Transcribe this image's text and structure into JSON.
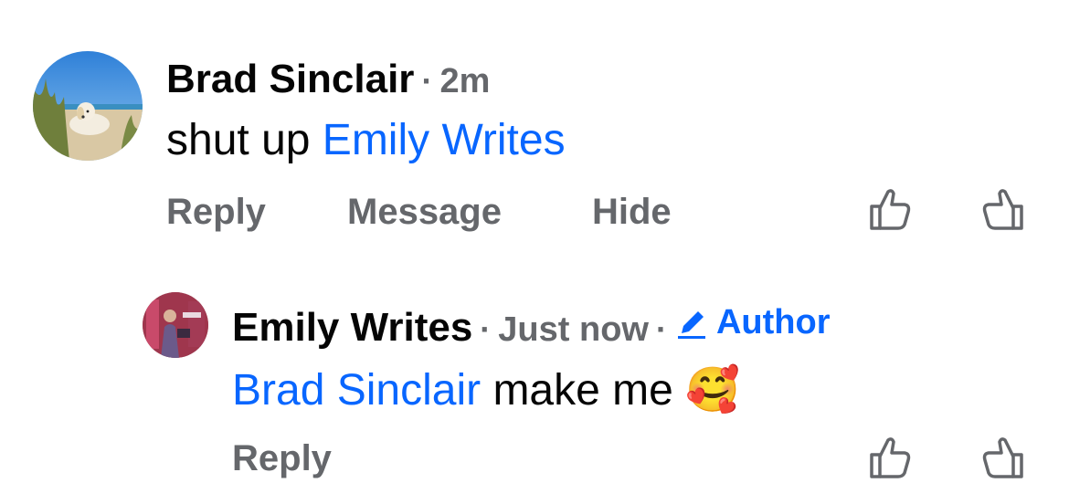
{
  "comments": [
    {
      "author": "Brad Sinclair",
      "separator": "·",
      "time": "2m",
      "body_prefix": "shut up ",
      "mention": "Emily Writes",
      "actions": {
        "reply": "Reply",
        "message": "Message",
        "hide": "Hide"
      },
      "avatar_icon": "beach-dog-photo"
    },
    {
      "author": "Emily Writes",
      "separator": "·",
      "time": "Just now",
      "separator2": "·",
      "author_badge": "Author",
      "mention": "Brad Sinclair",
      "body_suffix": " make me ",
      "emoji": "🥰",
      "actions": {
        "reply": "Reply"
      },
      "avatar_icon": "bookstore-photo"
    }
  ],
  "colors": {
    "link": "#0866ff",
    "muted": "#65676b",
    "text": "#050505"
  }
}
